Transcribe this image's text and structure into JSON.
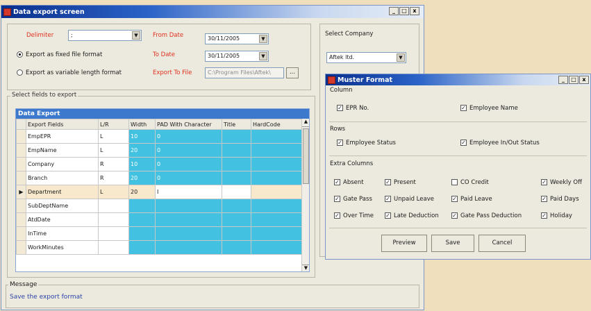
{
  "main": {
    "title": "Data export screen",
    "delimiter_label": "Delimiter",
    "delimiter_value": ";",
    "from_date_label": "From Date",
    "from_date_value": "30/11/2005",
    "to_date_label": "To Date",
    "to_date_value": "30/11/2005",
    "export_file_label": "Export To File",
    "export_file_value": "C:\\Program Files\\Aftek\\",
    "browse_label": "...",
    "radio_fixed": "Export as fixed file format",
    "radio_variable": "Export as variable length format",
    "company_group_label": "Select Company",
    "company_value": "Aftek ltd.",
    "fields_group_label": "Select fields to export",
    "grid_title": "Data Export",
    "columns": [
      "",
      "Export Fields",
      "L/R",
      "Width",
      "PAD With Character",
      "Title",
      "HardCode"
    ],
    "rows": [
      {
        "field": "EmpEPR",
        "lr": "L",
        "width": "10",
        "pad": "0"
      },
      {
        "field": "EmpName",
        "lr": "L",
        "width": "20",
        "pad": "0"
      },
      {
        "field": "Company",
        "lr": "R",
        "width": "10",
        "pad": "0"
      },
      {
        "field": "Branch",
        "lr": "R",
        "width": "20",
        "pad": "0"
      },
      {
        "field": "Department",
        "lr": "L",
        "width": "20",
        "pad": "I",
        "current": "▶"
      },
      {
        "field": "SubDeptName",
        "lr": "",
        "width": "",
        "pad": ""
      },
      {
        "field": "AtdDate",
        "lr": "",
        "width": "",
        "pad": ""
      },
      {
        "field": "InTime",
        "lr": "",
        "width": "",
        "pad": ""
      },
      {
        "field": "WorkMinutes",
        "lr": "",
        "width": "",
        "pad": ""
      }
    ],
    "message_label": "Message",
    "message_text": "Save the export format"
  },
  "muster": {
    "title": "Muster Format",
    "column_label": "Column",
    "column_items": [
      "EPR No.",
      "Employee Name"
    ],
    "rows_label": "Rows",
    "rows_items": [
      "Employee Status",
      "Employee In/Out Status"
    ],
    "extra_label": "Extra Columns",
    "extra_items": [
      {
        "label": "Absent",
        "checked": true
      },
      {
        "label": "Present",
        "checked": true
      },
      {
        "label": "CO Credit",
        "checked": false
      },
      {
        "label": "Weekly Off",
        "checked": true
      },
      {
        "label": "Gate Pass",
        "checked": true
      },
      {
        "label": "Unpaid Leave",
        "checked": true
      },
      {
        "label": "Paid Leave",
        "checked": true
      },
      {
        "label": "Paid Days",
        "checked": true
      },
      {
        "label": "Over Time",
        "checked": true
      },
      {
        "label": "Late Deduction",
        "checked": true
      },
      {
        "label": "Gate Pass Deduction",
        "checked": true
      },
      {
        "label": "Holiday",
        "checked": true
      }
    ],
    "preview_label": "Preview",
    "save_label": "Save",
    "cancel_label": "Cancel"
  },
  "window_controls": {
    "minimize": "_",
    "maximize": "□",
    "close": "x"
  }
}
